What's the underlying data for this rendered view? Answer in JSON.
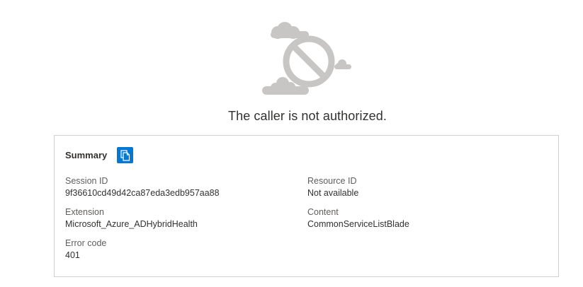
{
  "message": "The caller is not authorized.",
  "summary": {
    "title": "Summary",
    "copy_icon": "copy-icon",
    "fields": {
      "session_id": {
        "label": "Session ID",
        "value": "9f36610cd49d42ca87eda3edb957aa88"
      },
      "resource_id": {
        "label": "Resource ID",
        "value": "Not available"
      },
      "extension": {
        "label": "Extension",
        "value": "Microsoft_Azure_ADHybridHealth"
      },
      "content": {
        "label": "Content",
        "value": "CommonServiceListBlade"
      },
      "error_code": {
        "label": "Error code",
        "value": "401"
      }
    }
  },
  "colors": {
    "accent": "#0078d4",
    "illustration": "#c8c6c4",
    "border": "#d2d0ce"
  },
  "illustration_icon": "not-allowed-cloud-icon"
}
